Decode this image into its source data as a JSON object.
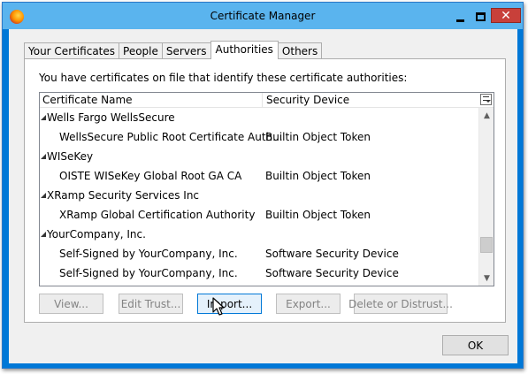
{
  "window": {
    "title": "Certificate Manager",
    "close_glyph": "✕"
  },
  "tabs": [
    {
      "label": "Your Certificates"
    },
    {
      "label": "People"
    },
    {
      "label": "Servers"
    },
    {
      "label": "Authorities",
      "active": true
    },
    {
      "label": "Others"
    }
  ],
  "panel": {
    "intro": "You have certificates on file that identify these certificate authorities:"
  },
  "tree": {
    "columns": [
      "Certificate Name",
      "Security Device"
    ],
    "groups": [
      {
        "name": "Wells Fargo WellsSecure",
        "children": [
          {
            "name": "WellsSecure Public Root Certificate Auth...",
            "device": "Builtin Object Token"
          }
        ]
      },
      {
        "name": "WISeKey",
        "children": [
          {
            "name": "OISTE WISeKey Global Root GA CA",
            "device": "Builtin Object Token"
          }
        ]
      },
      {
        "name": "XRamp Security Services Inc",
        "children": [
          {
            "name": "XRamp Global Certification Authority",
            "device": "Builtin Object Token"
          }
        ]
      },
      {
        "name": "YourCompany, Inc.",
        "children": [
          {
            "name": "Self-Signed by YourCompany, Inc.",
            "device": "Software Security Device"
          },
          {
            "name": "Self-Signed by YourCompany, Inc.",
            "device": "Software Security Device"
          }
        ]
      }
    ],
    "scroll_up_glyph": "▲",
    "scroll_down_glyph": "▼"
  },
  "buttons": {
    "view": "View...",
    "edit_trust": "Edit Trust...",
    "import": "Import...",
    "export": "Export...",
    "delete": "Delete or Distrust...",
    "ok": "OK"
  },
  "colors": {
    "titlebar": "#5ab4ee",
    "hover_border": "#0078d7",
    "close_button": "#c8403a"
  }
}
